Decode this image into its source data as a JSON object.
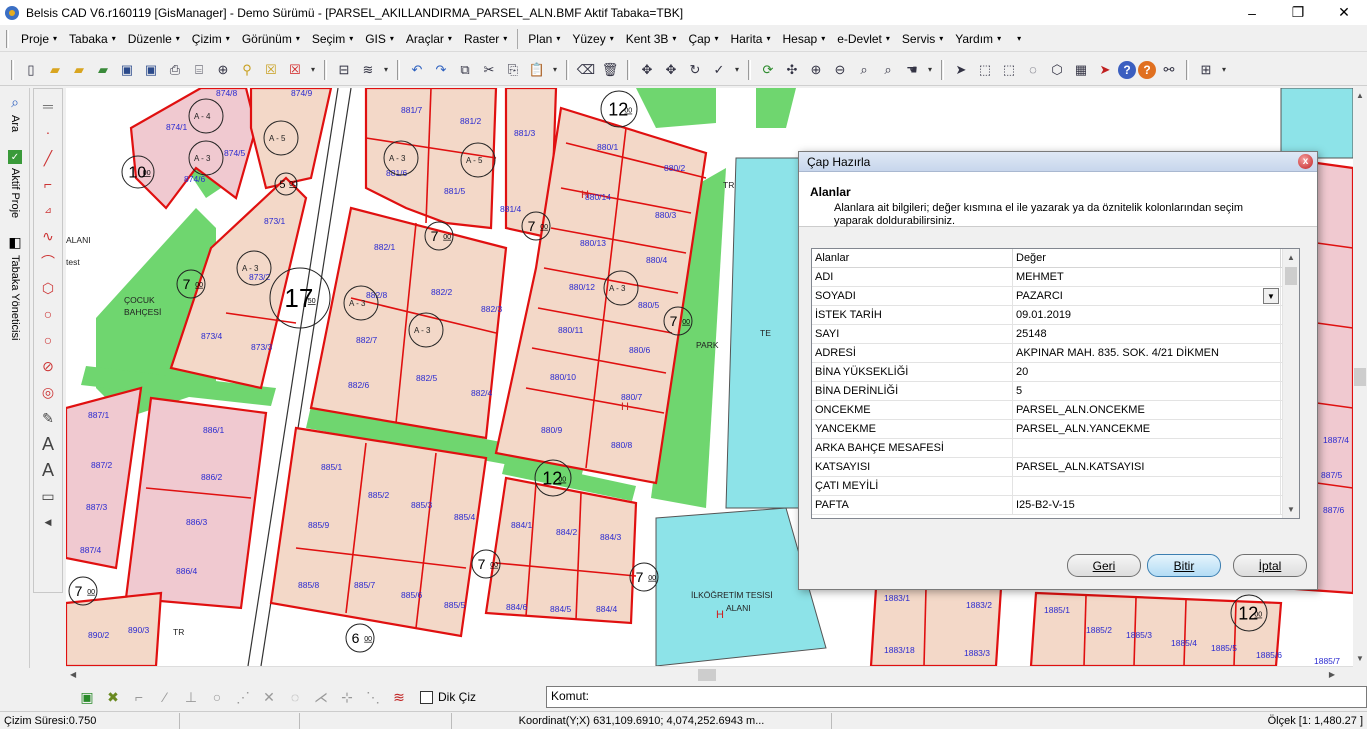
{
  "window": {
    "title": "Belsis CAD V6.r160119 [GisManager] - Demo Sürümü - [PARSEL_AKILLANDIRMA_PARSEL_ALN.BMF  Aktif Tabaka=TBK]",
    "minimize": "–",
    "restore": "❐",
    "close": "✕"
  },
  "menu": {
    "items": [
      "Proje",
      "Tabaka",
      "Düzenle",
      "Çizim",
      "Görünüm",
      "Seçim",
      "GIS",
      "Araçlar",
      "Raster",
      "Plan",
      "Yüzey",
      "Kent 3B",
      "Çap",
      "Harita",
      "Hesap",
      "e-Devlet",
      "Servis",
      "Yardım"
    ],
    "arrow": "▾"
  },
  "sidebar": {
    "tabs": [
      {
        "label": "Ara",
        "icon": "search-icon"
      },
      {
        "label": "Aktif Proje",
        "icon": "check-icon"
      },
      {
        "label": "Tabaka Yöneticisi",
        "icon": "layers-icon"
      }
    ]
  },
  "map": {
    "parcel_labels": [
      "874/8",
      "874/9",
      "874/1",
      "874/5",
      "874/6",
      "873/1",
      "873/2",
      "873/4",
      "873/3",
      "881/7",
      "881/2",
      "881/3",
      "881/6",
      "881/5",
      "881/4",
      "882/1",
      "882/8",
      "882/2",
      "882/3",
      "882/7",
      "882/6",
      "882/5",
      "882/4",
      "880/1",
      "880/2",
      "880/14",
      "880/3",
      "880/13",
      "880/4",
      "880/12",
      "880/5",
      "880/11",
      "880/6",
      "880/10",
      "880/7",
      "880/9",
      "880/8",
      "887/1",
      "887/2",
      "887/3",
      "887/4",
      "886/1",
      "886/2",
      "886/3",
      "886/4",
      "885/1",
      "885/2",
      "885/3",
      "885/4",
      "885/9",
      "885/8",
      "885/7",
      "885/6",
      "885/5",
      "884/1",
      "884/2",
      "884/3",
      "884/6",
      "884/5",
      "884/4",
      "890/2",
      "890/3",
      "1883/1",
      "1883/2",
      "1883/18",
      "1883/3",
      "1885/1",
      "1885/2",
      "1885/3",
      "1885/4",
      "1885/5",
      "1885/6",
      "1885/7",
      "1887/4",
      "887/5",
      "887/6"
    ],
    "area_labels": [
      "ÇOCUK",
      "BAHÇESİ",
      "PARK",
      "TR",
      "TR",
      "İLKÖĞRETİM TESİSİ",
      "ALANI",
      "ALANI",
      "test",
      "TE"
    ],
    "road_widths": [
      "17",
      "12",
      "12",
      "12",
      "10",
      "7",
      "7",
      "7",
      "7",
      "7",
      "7",
      "7",
      "6",
      "5"
    ],
    "road_sub": "50",
    "road_sub2": "00",
    "zone_codes": [
      "A - 4",
      "A - 5",
      "A - 3",
      "A - 3",
      "A - 5",
      "A - 3",
      "A - 3",
      "A - 3",
      "A - 3"
    ],
    "house_mark": "H"
  },
  "dialog": {
    "title": "Çap Hazırla",
    "close": "x",
    "heading": "Alanlar",
    "description": "Alanlara ait bilgileri; değer kısmına el ile yazarak ya da öznitelik kolonlarından seçim yaparak doldurabilirsiniz.",
    "columns": [
      "Alanlar",
      "Değer"
    ],
    "rows": [
      {
        "name": "ADI",
        "value": "MEHMET"
      },
      {
        "name": "SOYADI",
        "value": "PAZARCI"
      },
      {
        "name": "İSTEK TARİH",
        "value": "09.01.2019"
      },
      {
        "name": "SAYI",
        "value": "25148"
      },
      {
        "name": "ADRESİ",
        "value": "AKPINAR MAH. 835. SOK. 4/21 DİKMEN"
      },
      {
        "name": "BİNA YÜKSEKLİĞİ",
        "value": "20"
      },
      {
        "name": "BİNA DERİNLİĞİ",
        "value": "5"
      },
      {
        "name": "ONCEKME",
        "value": "PARSEL_ALN.ONCEKME"
      },
      {
        "name": "YANCEKME",
        "value": "PARSEL_ALN.YANCEKME"
      },
      {
        "name": "ARKA BAHÇE MESAFESİ",
        "value": ""
      },
      {
        "name": "KATSAYISI",
        "value": "PARSEL_ALN.KATSAYISI"
      },
      {
        "name": "ÇATI MEYİLİ",
        "value": ""
      },
      {
        "name": "PAFTA",
        "value": "I25-B2-V-15"
      }
    ],
    "buttons": {
      "back": "Geri",
      "finish": "Bitir",
      "cancel": "İptal"
    }
  },
  "command_bar": {
    "dik_ciz": "Dik Çiz",
    "command_label": "Komut:"
  },
  "status": {
    "draw_time": "Çizim Süresi:0.750",
    "coordinate": "Koordinat(Y;X)  631,109.6910; 4,074,252.6943 m...",
    "scale": "Ölçek [1: 1,480.27 ]"
  },
  "colors": {
    "parcel_border": "#e01010",
    "parcel_fill": "#f3d8c8",
    "residential_fill": "#f0c9d0",
    "park_green": "#6fd66f",
    "school_cyan": "#8de3e8",
    "label_blue": "#2a2ad0",
    "dialog_button_default": "#b3dcf5"
  }
}
